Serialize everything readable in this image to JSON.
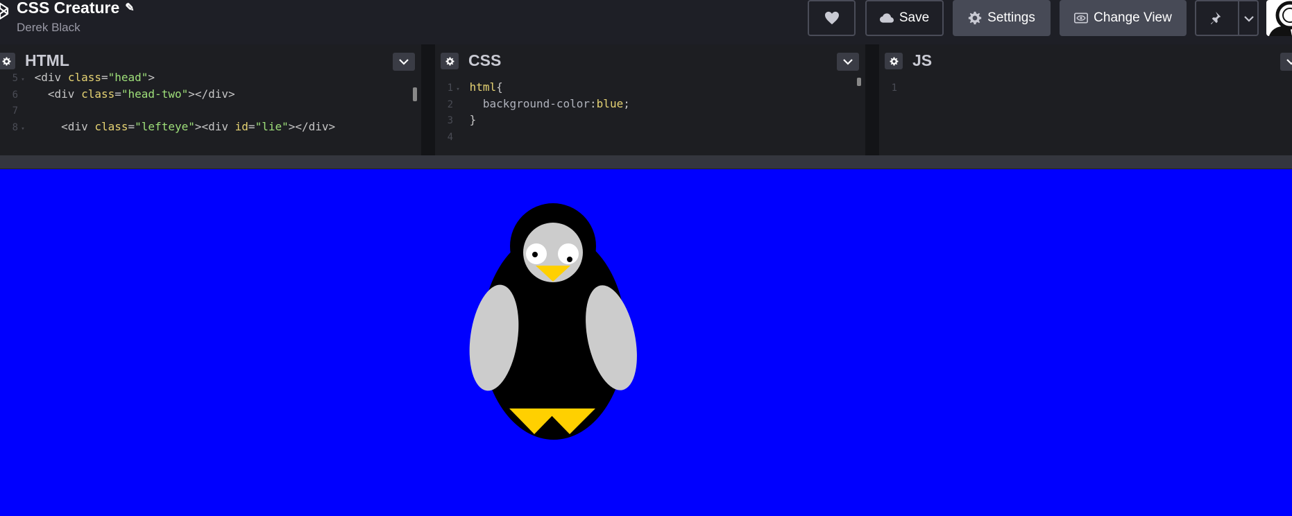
{
  "header": {
    "title": "CSS Creature",
    "author": "Derek Black",
    "buttons": {
      "save": "Save",
      "settings": "Settings",
      "change_view": "Change View"
    }
  },
  "editors": {
    "html": {
      "title": "HTML",
      "lines": [
        {
          "num": "5",
          "tokens": [
            {
              "t": "<div ",
              "c": "tag"
            },
            {
              "t": "class",
              "c": "attr"
            },
            {
              "t": "=",
              "c": "text"
            },
            {
              "t": "\"head\"",
              "c": "str"
            },
            {
              "t": ">",
              "c": "tag"
            }
          ]
        },
        {
          "num": "6",
          "tokens": [
            {
              "t": "  <div ",
              "c": "tag"
            },
            {
              "t": "class",
              "c": "attr"
            },
            {
              "t": "=",
              "c": "text"
            },
            {
              "t": "\"head-two\"",
              "c": "str"
            },
            {
              "t": "></div>",
              "c": "tag"
            }
          ]
        },
        {
          "num": "7",
          "tokens": []
        },
        {
          "num": "8",
          "tokens": [
            {
              "t": "    <div ",
              "c": "tag"
            },
            {
              "t": "class",
              "c": "attr"
            },
            {
              "t": "=",
              "c": "text"
            },
            {
              "t": "\"lefteye\"",
              "c": "str"
            },
            {
              "t": "><div ",
              "c": "tag"
            },
            {
              "t": "id",
              "c": "attr"
            },
            {
              "t": "=",
              "c": "text"
            },
            {
              "t": "\"lie\"",
              "c": "str"
            },
            {
              "t": "></div>",
              "c": "tag"
            }
          ]
        }
      ]
    },
    "css": {
      "title": "CSS",
      "lines": [
        {
          "num": "1",
          "tokens": [
            {
              "t": "html",
              "c": "sel"
            },
            {
              "t": "{",
              "c": "text"
            }
          ]
        },
        {
          "num": "2",
          "tokens": [
            {
              "t": "  background-color",
              "c": "prop"
            },
            {
              "t": ":",
              "c": "text"
            },
            {
              "t": "blue",
              "c": "val"
            },
            {
              "t": ";",
              "c": "text"
            }
          ]
        },
        {
          "num": "3",
          "tokens": [
            {
              "t": "}",
              "c": "text"
            }
          ]
        },
        {
          "num": "4",
          "tokens": []
        }
      ]
    },
    "js": {
      "title": "JS",
      "lines": [
        {
          "num": "1",
          "tokens": []
        }
      ]
    }
  },
  "preview": {
    "background": "#0000ff",
    "colors": {
      "body": "#000000",
      "face": "#cccccc",
      "eye": "#ffffff",
      "pupil": "#000000",
      "beak": "#ffd000",
      "feet": "#ffd000",
      "wings": "#cccccc"
    }
  }
}
